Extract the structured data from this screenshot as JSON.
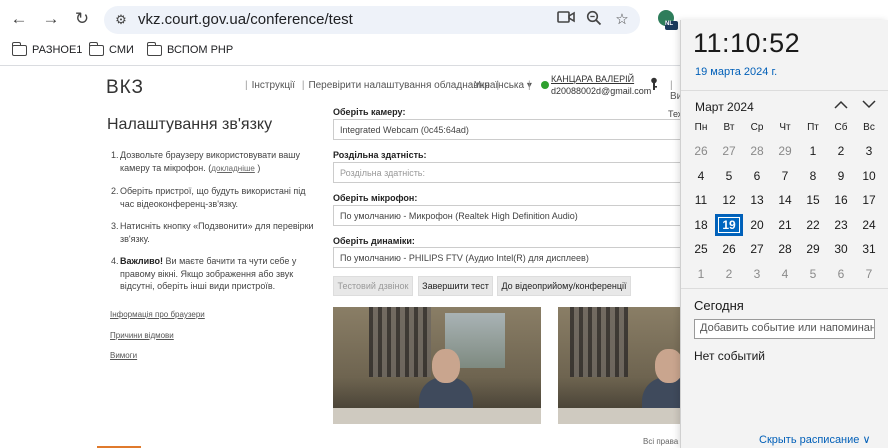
{
  "browser": {
    "url": "vkz.court.gov.ua/conference/test",
    "profile_badge": "NL",
    "bookmarks": [
      {
        "label": "РАЗНОЕ1"
      },
      {
        "label": "СМИ"
      },
      {
        "label": "ВСПОМ РНР"
      }
    ]
  },
  "site": {
    "logo": "ВКЗ",
    "nav": {
      "instructions": "Інструкції",
      "check_settings": "Перевірити налаштування обладнання",
      "language": "Українська ▾",
      "extra": "Ви",
      "tech": "Тех"
    },
    "user": {
      "name": "КАНЦАРА ВАЛЕРІЙ",
      "email": "d20088002d@gmail.com",
      "status_color": "#2ea02e"
    },
    "title": "Налаштування зв'язку",
    "steps": [
      {
        "num": "1.",
        "text": "Дозвольте браузеру використовувати вашу камеру та мікрофон. (",
        "link": "докладніше",
        "tail": " )"
      },
      {
        "num": "2.",
        "text": "Оберіть пристрої, що будуть використані під час відеоконференц-зв'язку."
      },
      {
        "num": "3.",
        "text": "Натисніть кнопку «Подзвонити» для перевірки зв'язку."
      },
      {
        "num": "4.",
        "bold": "Важливо!",
        "text": " Ви маєте бачити та чути себе у правому вікні. Якщо зображення або звук відсутні, оберіть інші види пристроїв."
      }
    ],
    "side_links": [
      "Інформація про браузери",
      "Причини відмови",
      "Вимоги"
    ],
    "form": {
      "camera_label": "Оберіть камеру:",
      "camera_value": "Integrated Webcam (0c45:64ad)",
      "resolution_label": "Роздільна здатність:",
      "resolution_placeholder": "Роздільна здатність:",
      "mic_label": "Оберіть мікрофон:",
      "mic_value": "По умолчанию - Микрофон (Realtek High Definition Audio)",
      "speakers_label": "Оберіть динаміки:",
      "speakers_value": "По умолчанию - PHILIPS FTV (Аудио Intel(R) для дисплеев)"
    },
    "buttons": {
      "test_call": "Тестовий дзвінок",
      "end_test": "Завершити тест",
      "to_conference": "До відеоприйому/конференції"
    },
    "footer": "Всі права з"
  },
  "calendar": {
    "time": "11:10:52",
    "date": "19 марта 2024 г.",
    "month": "Март 2024",
    "weekdays": [
      "Пн",
      "Вт",
      "Ср",
      "Чт",
      "Пт",
      "Сб",
      "Вс"
    ],
    "weeks": [
      [
        "26",
        "27",
        "28",
        "29",
        "1",
        "2",
        "3"
      ],
      [
        "4",
        "5",
        "6",
        "7",
        "8",
        "9",
        "10"
      ],
      [
        "11",
        "12",
        "13",
        "14",
        "15",
        "16",
        "17"
      ],
      [
        "18",
        "19",
        "20",
        "21",
        "22",
        "23",
        "24"
      ],
      [
        "25",
        "26",
        "27",
        "28",
        "29",
        "30",
        "31"
      ],
      [
        "1",
        "2",
        "3",
        "4",
        "5",
        "6",
        "7"
      ]
    ],
    "today_label": "Сегодня",
    "event_placeholder": "Добавить событие или напоминание",
    "no_events": "Нет событий",
    "hide_schedule": "Скрыть расписание ∨",
    "accent": "#0067c0"
  }
}
